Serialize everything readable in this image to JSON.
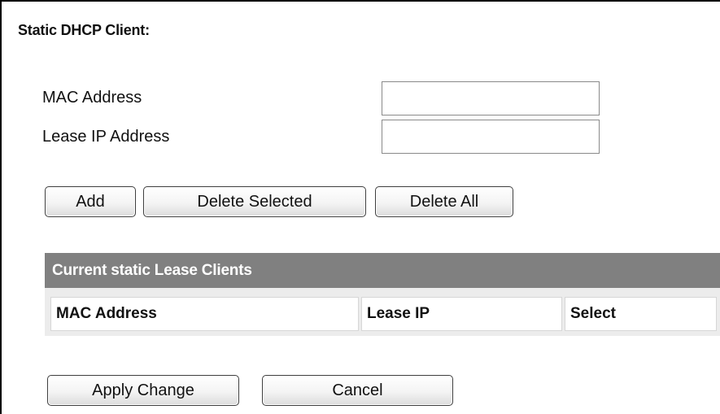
{
  "section_title": "Static DHCP Client:",
  "form": {
    "mac_label": "MAC Address",
    "mac_value": "",
    "ip_label": "Lease IP Address",
    "ip_value": ""
  },
  "buttons": {
    "add": "Add",
    "delete_selected": "Delete Selected",
    "delete_all": "Delete All",
    "apply_change": "Apply Change",
    "cancel": "Cancel"
  },
  "lease_table": {
    "title": "Current static Lease Clients",
    "columns": [
      "MAC Address",
      "Lease IP",
      "Select"
    ],
    "rows": []
  }
}
